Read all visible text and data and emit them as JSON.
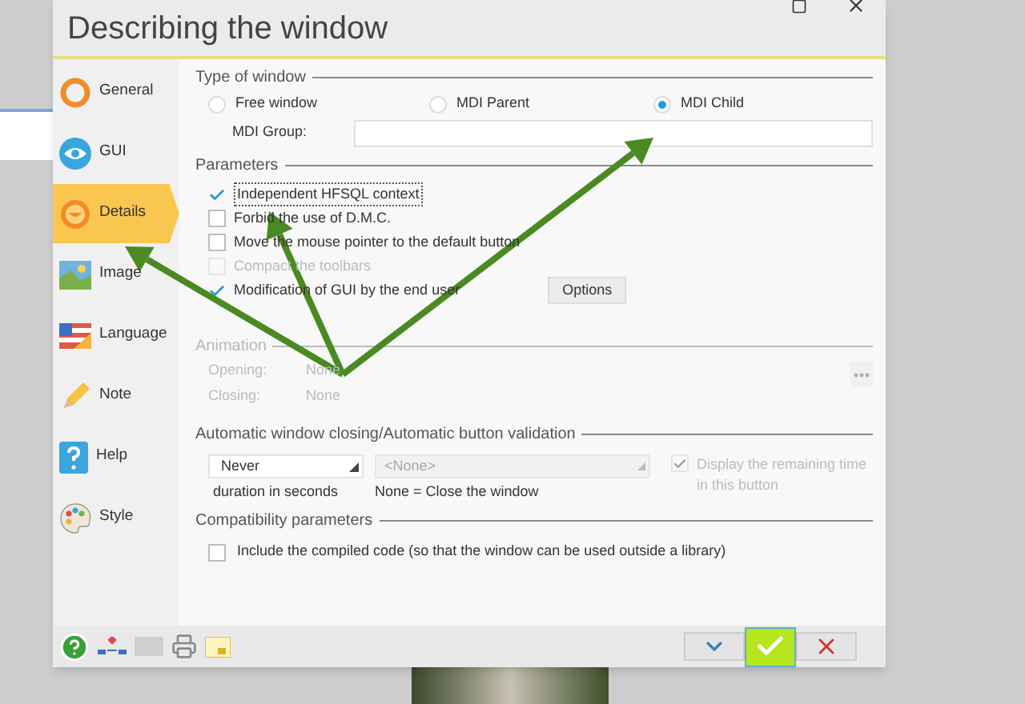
{
  "window": {
    "title": "Describing the window"
  },
  "sidebar": {
    "items": [
      {
        "label": "General",
        "kind": "general",
        "selected": false
      },
      {
        "label": "GUI",
        "kind": "gui",
        "selected": false
      },
      {
        "label": "Details",
        "kind": "details",
        "selected": true
      },
      {
        "label": "Image",
        "kind": "image",
        "selected": false
      },
      {
        "label": "Language",
        "kind": "language",
        "selected": false
      },
      {
        "label": "Note",
        "kind": "note",
        "selected": false
      },
      {
        "label": "Help",
        "kind": "help",
        "selected": false
      },
      {
        "label": "Style",
        "kind": "style",
        "selected": false
      }
    ]
  },
  "window_type": {
    "title": "Type of window",
    "options": [
      {
        "label": "Free window",
        "selected": false
      },
      {
        "label": "MDI Parent",
        "selected": false
      },
      {
        "label": "MDI Child",
        "selected": true
      }
    ],
    "mdi_group_label": "MDI Group:"
  },
  "parameters": {
    "title": "Parameters",
    "items": [
      {
        "label": "Independent HFSQL context",
        "checked": true,
        "disabled": false
      },
      {
        "label": "Forbid the use of D.M.C.",
        "checked": false,
        "disabled": false
      },
      {
        "label": "Move the mouse pointer to the default button",
        "checked": false,
        "disabled": false
      },
      {
        "label": "Compact the toolbars",
        "checked": false,
        "disabled": true
      },
      {
        "label": "Modification of GUI by the end user",
        "checked": true,
        "disabled": false
      }
    ],
    "options_button": "Options"
  },
  "animation": {
    "title": "Animation",
    "disabled": true,
    "rows": [
      {
        "label": "Opening:",
        "value": "None"
      },
      {
        "label": "Closing:",
        "value": "None"
      }
    ]
  },
  "auto_closing": {
    "title": "Automatic window closing/Automatic button validation",
    "duration": {
      "value": "Never",
      "caption": "duration in seconds"
    },
    "button": {
      "value": "<None>",
      "caption": "None = Close the window"
    },
    "display_remaining": {
      "label": "Display the remaining time in this button",
      "checked": true,
      "disabled": true
    }
  },
  "compatibility": {
    "title": "Compatibility parameters",
    "items": [
      {
        "label": "Include the compiled code (so that the window can be used outside a library)",
        "checked": false
      }
    ]
  }
}
